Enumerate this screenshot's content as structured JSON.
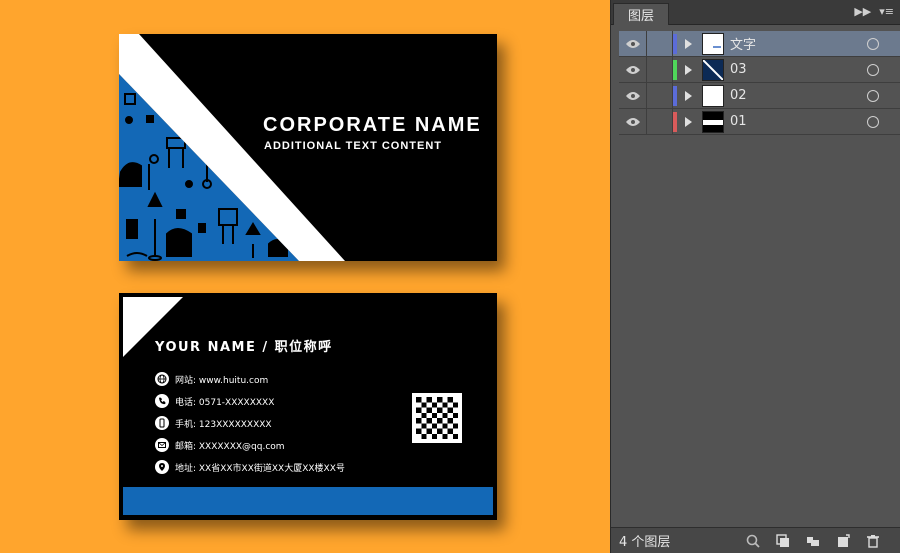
{
  "canvas": {
    "front": {
      "title": "CORPORATE NAME",
      "subtitle": "ADDITIONAL TEXT CONTENT"
    },
    "back": {
      "name": "YOUR NAME / 职位称呼",
      "contacts": [
        {
          "icon": "globe-icon",
          "text": "网站: www.huitu.com"
        },
        {
          "icon": "phone-icon",
          "text": "电话: 0571-XXXXXXXX"
        },
        {
          "icon": "mobile-icon",
          "text": "手机: 123XXXXXXXXX"
        },
        {
          "icon": "mail-icon",
          "text": "邮箱: XXXXXXX@qq.com"
        },
        {
          "icon": "location-icon",
          "text": "地址: XX省XX市XX街道XX大厦XX楼XX号"
        }
      ]
    },
    "colors": {
      "background": "#ffa52d",
      "card": "#000000",
      "accent": "#1368b6"
    }
  },
  "layers_panel": {
    "tab": "图层",
    "layers": [
      {
        "name": "文字",
        "color": "#5b6cd9",
        "selected": true
      },
      {
        "name": "03",
        "color": "#4fd65a",
        "selected": false
      },
      {
        "name": "02",
        "color": "#5b6cd9",
        "selected": false
      },
      {
        "name": "01",
        "color": "#d95b5b",
        "selected": false
      }
    ],
    "footer": {
      "count_label": "4 个图层"
    }
  }
}
